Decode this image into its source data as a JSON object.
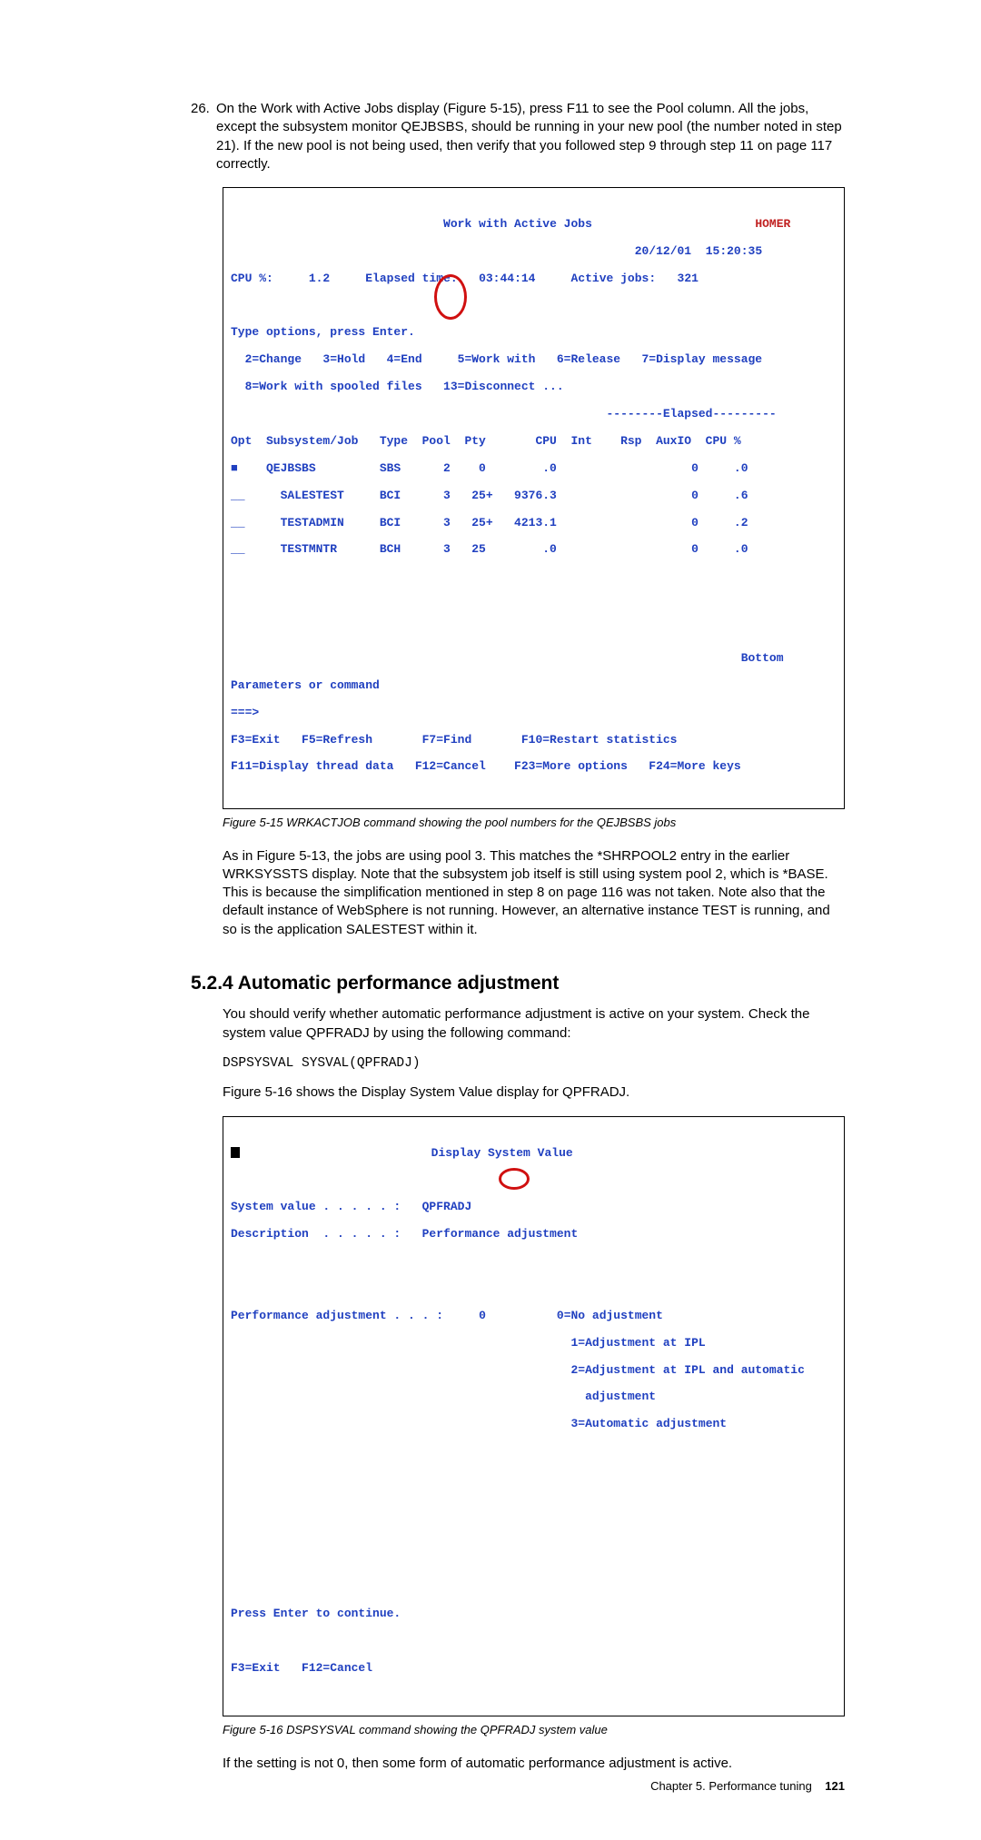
{
  "list_item_number": "26.",
  "list_item_text": "On the Work with Active Jobs display (Figure 5-15), press F11 to see the Pool column. All the jobs, except the subsystem monitor QEJBSBS, should be running in your new pool (the number noted in step 21). If the new pool is not being used, then verify that you followed step 9 through step 11 on page 117 correctly.",
  "term1": {
    "title": "Work with Active Jobs",
    "system": "HOMER",
    "date": "20/12/01",
    "time": "15:20:35",
    "cpu_label": "CPU %:",
    "cpu_val": "1.2",
    "elapsed_label": "Elapsed time:",
    "elapsed_val": "03:44:14",
    "active_label": "Active jobs:",
    "active_val": "321",
    "type_opts_1": "Type options, press Enter.",
    "type_opts_2": "  2=Change   3=Hold   4=End     5=Work with   6=Release   7=Display message",
    "type_opts_3": "  8=Work with spooled files   13=Disconnect ...",
    "elapsed_header": "--------Elapsed---------",
    "col_header": "Opt  Subsystem/Job   Type  Pool  Pty       CPU  Int    Rsp  AuxIO  CPU %",
    "rows": [
      "■    QEJBSBS         SBS      2    0        .0                   0     .0",
      "__     SALESTEST     BCI      3   25+   9376.3                   0     .6",
      "__     TESTADMIN     BCI      3   25+   4213.1                   0     .2",
      "__     TESTMNTR      BCH      3   25        .0                   0     .0"
    ],
    "bottom": "Bottom",
    "param_label": "Parameters or command",
    "prompt": "===>",
    "fkeys_1": "F3=Exit   F5=Refresh       F7=Find       F10=Restart statistics",
    "fkeys_2": "F11=Display thread data   F12=Cancel    F23=More options   F24=More keys"
  },
  "fig1_caption": "Figure 5-15   WRKACTJOB command showing the pool numbers for the QEJBSBS jobs",
  "para1": "As in Figure 5-13, the jobs are using pool 3. This matches the *SHRPOOL2 entry in the earlier WRKSYSSTS display. Note that the subsystem job itself is still using system pool 2, which is *BASE. This is because the simplification mentioned in step 8 on page 116 was not taken. Note also that the default instance of WebSphere is not running. However, an alternative instance TEST is running, and so is the application SALESTEST within it.",
  "section_heading": "5.2.4  Automatic performance adjustment",
  "para2": "You should verify whether automatic performance adjustment is active on your system. Check the system value QPFRADJ by using the following command:",
  "command": "DSPSYSVAL SYSVAL(QPFRADJ)",
  "para3": "Figure 5-16 shows the Display System Value display for QPFRADJ.",
  "term2": {
    "title": "Display System Value",
    "sysval_label": "System value . . . . . :   QPFRADJ",
    "desc_label": "Description  . . . . . :   Performance adjustment",
    "pa_label": "Performance adjustment . . . :",
    "pa_value": "0",
    "opt0": "0=No adjustment",
    "opt1": "1=Adjustment at IPL",
    "opt2": "2=Adjustment at IPL and automatic",
    "opt2b": "  adjustment",
    "opt3": "3=Automatic adjustment",
    "press_enter": "Press Enter to continue.",
    "fkeys": "F3=Exit   F12=Cancel"
  },
  "fig2_caption": "Figure 5-16   DSPSYSVAL command showing the QPFRADJ system value",
  "para4": "If the setting is not 0, then some form of automatic performance adjustment is active.",
  "footer_chapter": "Chapter 5. Performance tuning",
  "footer_page": "121"
}
